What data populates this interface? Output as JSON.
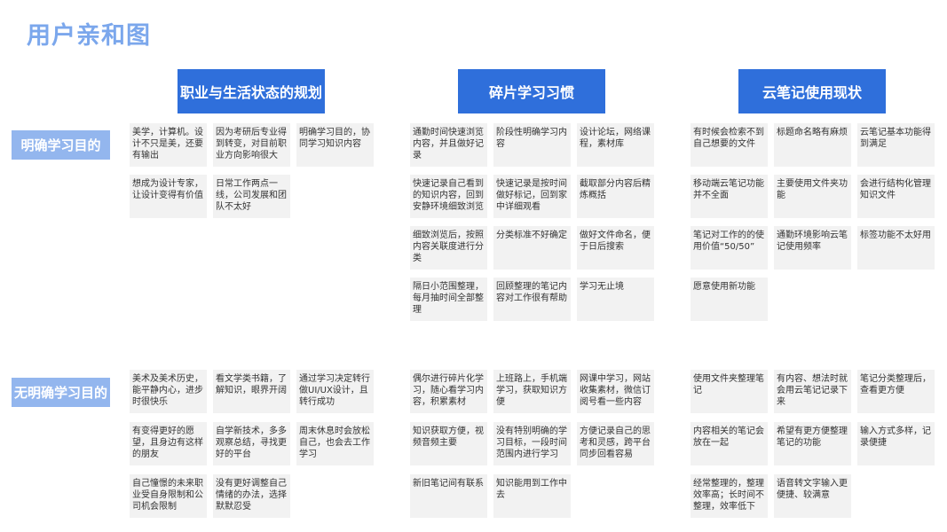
{
  "title": "用户亲和图",
  "columns": [
    {
      "label": "职业与生活状态的规划"
    },
    {
      "label": "碎片学习习惯"
    },
    {
      "label": "云笔记使用现状"
    }
  ],
  "rows": [
    {
      "label": "明确学习目的"
    },
    {
      "label": "无明确学习目的"
    }
  ],
  "notes": [
    {
      "text": "美学，计算机。设计不只是美，还要有输出"
    },
    {
      "text": "因为考研后专业得到转变，对目前职业方向影响很大"
    },
    {
      "text": "明确学习目的，协同学习知识内容"
    },
    {
      "text": "想成为设计专家，让设计变得有价值"
    },
    {
      "text": "日常工作两点一线，公司发展和团队不太好"
    },
    {
      "text": "通勤时间快速浏览内容，并且做好记录"
    },
    {
      "text": "阶段性明确学习内容"
    },
    {
      "text": "设计论坛，网络课程，素材库"
    },
    {
      "text": "快速记录自己看到的知识内容，回到安静环境细致浏览"
    },
    {
      "text": "快速记录是按时间做好标记，回到家中详细观看"
    },
    {
      "text": "截取部分内容后精炼概括"
    },
    {
      "text": "细致浏览后，按照内容关联度进行分类"
    },
    {
      "text": "分类标准不好确定"
    },
    {
      "text": "做好文件命名，便于日后搜索"
    },
    {
      "text": "隔日小范围整理，每月抽时间全部整理"
    },
    {
      "text": "回顾整理的笔记内容对工作很有帮助"
    },
    {
      "text": "学习无止境"
    },
    {
      "text": "有时候会检索不到自己想要的文件"
    },
    {
      "text": "标题命名略有麻烦"
    },
    {
      "text": "云笔记基本功能得到满足"
    },
    {
      "text": "移动端云笔记功能并不全面"
    },
    {
      "text": "主要使用文件夹功能"
    },
    {
      "text": "会进行结构化管理知识文件"
    },
    {
      "text": "笔记对工作的的使用价值“50/50”"
    },
    {
      "text": "通勤环境影响云笔记使用频率"
    },
    {
      "text": "标签功能不太好用"
    },
    {
      "text": "愿意使用新功能"
    },
    {
      "text": "美术及美术历史，能平静内心，进步时很快乐"
    },
    {
      "text": "看文学类书籍，了解知识，眼界开阔"
    },
    {
      "text": "通过学习决定转行做UI/UX设计，且转行成功"
    },
    {
      "text": "有变得更好的愿望，且身边有这样的朋友"
    },
    {
      "text": "自学新技术，多多观察总结，寻找更好的平台"
    },
    {
      "text": "周末休息时会放松自己，也会去工作学习"
    },
    {
      "text": "自己憧憬的未来职业受自身限制和公司机会限制"
    },
    {
      "text": "没有更好调整自己情绪的办法，选择默默忍受"
    },
    {
      "text": "偶尔进行碎片化学习，随心看学习内容，积累素材"
    },
    {
      "text": "上班路上，手机端学习，获取知识方便"
    },
    {
      "text": "网课中学习，网站收集素材，微信订阅号看一些内容"
    },
    {
      "text": "知识获取方便，视频音频主要"
    },
    {
      "text": "没有特别明确的学习目标，一段时间范围内进行学习"
    },
    {
      "text": "方便记录自己的思考和灵感，跨平台同步回看容易"
    },
    {
      "text": "新旧笔记间有联系"
    },
    {
      "text": "知识能用到工作中去"
    },
    {
      "text": "使用文件夹整理笔记"
    },
    {
      "text": "有内容、想法时就会用云笔记记录下来"
    },
    {
      "text": "笔记分类整理后，查看更方便"
    },
    {
      "text": "内容相关的笔记会放在一起"
    },
    {
      "text": "希望有更方便整理笔记的功能"
    },
    {
      "text": "输入方式多样，记录便捷"
    },
    {
      "text": "经常整理的，整理效率高；长时间不整理，效率低下"
    },
    {
      "text": "语音转文字输入更便捷、较满意"
    }
  ]
}
